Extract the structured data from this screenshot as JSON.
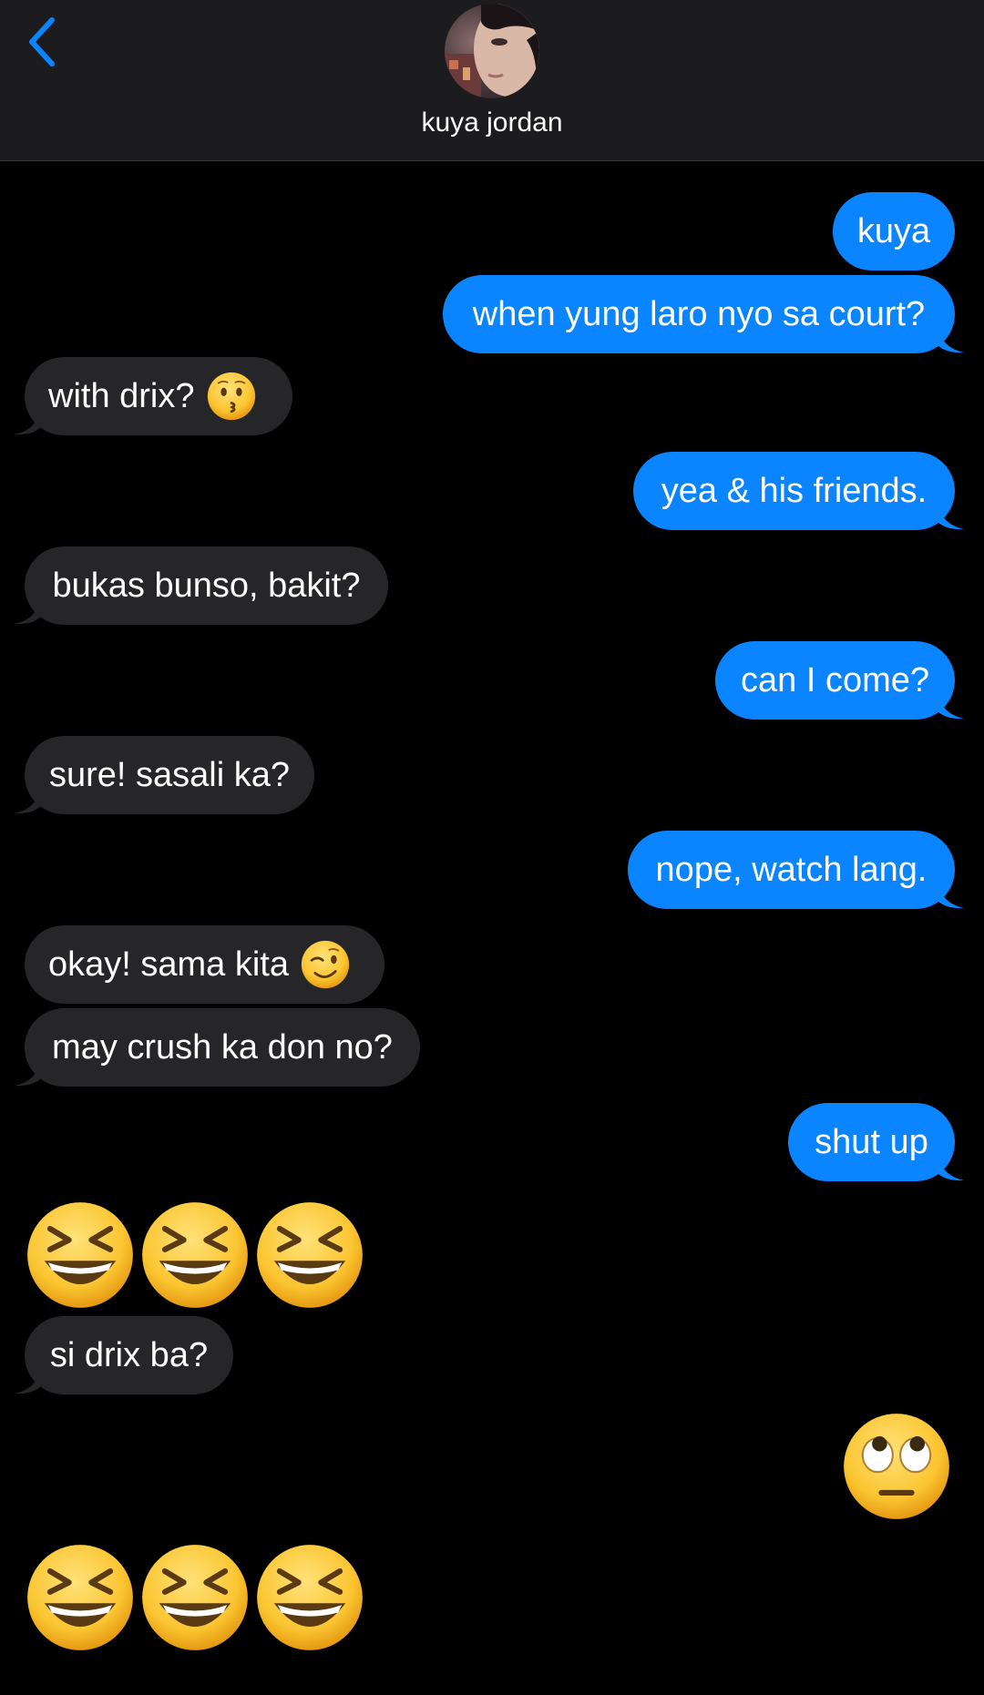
{
  "header": {
    "back_icon": "chevron-left-icon",
    "contact_name": "kuya jordan",
    "avatar": "contact-photo"
  },
  "colors": {
    "sent_bubble": "#0a84ff",
    "received_bubble": "#262628",
    "header_bg": "#1c1c1e",
    "accent": "#0a84ff"
  },
  "messages": [
    {
      "from": "me",
      "text": "kuya"
    },
    {
      "from": "me",
      "text": "when yung laro nyo sa court?"
    },
    {
      "from": "them",
      "text": "with drix?",
      "emoji": "kissing-face-icon"
    },
    {
      "from": "me",
      "text": "yea & his friends."
    },
    {
      "from": "them",
      "text": "bukas bunso, bakit?"
    },
    {
      "from": "me",
      "text": "can I come?"
    },
    {
      "from": "them",
      "text": "sure! sasali ka?"
    },
    {
      "from": "me",
      "text": "nope, watch lang."
    },
    {
      "from": "them",
      "text": "okay! sama kita",
      "emoji": "winking-face-icon"
    },
    {
      "from": "them",
      "text": "may crush ka don no?"
    },
    {
      "from": "me",
      "text": "shut up"
    },
    {
      "from": "them",
      "emoji_only": [
        "laughing-face-icon",
        "laughing-face-icon",
        "laughing-face-icon"
      ]
    },
    {
      "from": "them",
      "text": "si drix ba?"
    },
    {
      "from": "me",
      "emoji_only": [
        "rolling-eyes-face-icon"
      ]
    },
    {
      "from": "them",
      "emoji_only": [
        "laughing-face-icon",
        "laughing-face-icon",
        "laughing-face-icon"
      ]
    }
  ]
}
